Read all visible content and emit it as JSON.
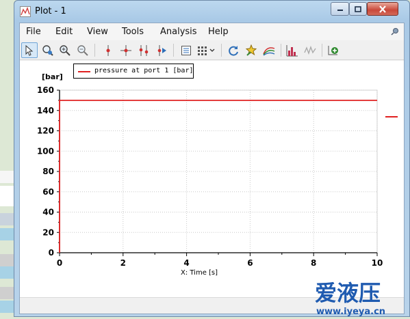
{
  "window": {
    "title": "Plot - 1"
  },
  "menu": [
    "File",
    "Edit",
    "View",
    "Tools",
    "Analysis",
    "Help"
  ],
  "toolbar": {
    "icons": [
      "pointer-icon",
      "zoom-fit-icon",
      "zoom-in-icon",
      "zoom-out-icon",
      "marker-icon",
      "crosshair-icon",
      "markers-pair-icon",
      "marker-play-icon",
      "data-table-icon",
      "grid-layout-icon",
      "refresh-icon",
      "pin-star-icon",
      "curves-icon",
      "histogram-icon",
      "waveform-icon",
      "add-plot-icon"
    ]
  },
  "chart_data": {
    "type": "line",
    "title": "",
    "unit_label": "[bar]",
    "xlabel": "X: Time [s]",
    "ylabel": "",
    "xlim": [
      0,
      10
    ],
    "ylim": [
      0,
      160
    ],
    "x_ticks": [
      "0",
      "2",
      "4",
      "6",
      "8",
      "10"
    ],
    "y_ticks": [
      "0",
      "20",
      "40",
      "60",
      "80",
      "100",
      "120",
      "140",
      "160"
    ],
    "grid": true,
    "legend_placement": "top-left",
    "series": [
      {
        "name": "pressure at port 1 [bar]",
        "color": "#e02020",
        "x": [
          0,
          0,
          10
        ],
        "y": [
          0,
          150,
          150
        ]
      }
    ]
  },
  "colors": {
    "series": "#e02020",
    "grid": "#c8c8c8",
    "axis": "#000000"
  },
  "watermark": {
    "brand": "爱液压",
    "url": "www.iyeya.cn"
  }
}
